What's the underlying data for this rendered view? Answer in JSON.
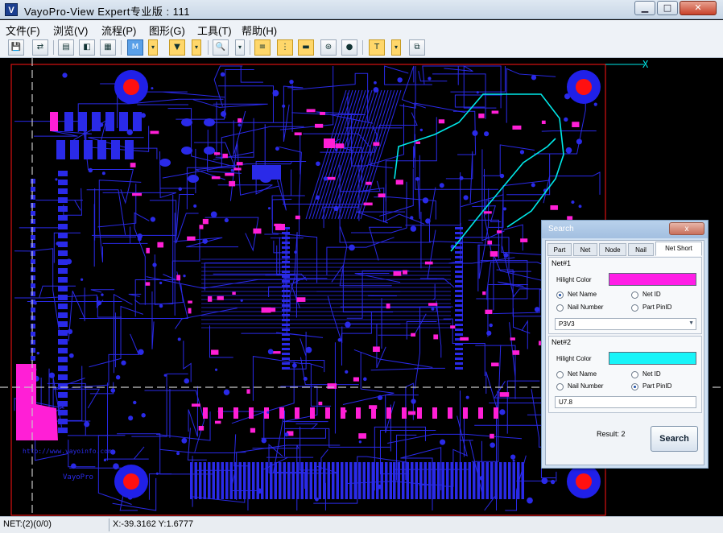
{
  "window": {
    "title": "VayoPro-View Expert专业版 : 111",
    "icon_letter": "V",
    "controls": {
      "minimize": "▁",
      "maximize": "□",
      "close": "✕"
    }
  },
  "menu": [
    {
      "label": "文件(F)"
    },
    {
      "label": "浏览(V)"
    },
    {
      "label": "流程(P)"
    },
    {
      "label": "图形(G)"
    },
    {
      "label": "工具(T)"
    },
    {
      "label": "帮助(H)"
    }
  ],
  "toolbar": {
    "glyphs": [
      "💾",
      "⇄",
      "▤",
      "◧",
      "▦",
      "M",
      "▾",
      "▼",
      "▾",
      "🔍",
      "▾",
      "≡",
      "⋮",
      "▬",
      "⊛",
      "●",
      "T",
      "▾",
      "⧉"
    ]
  },
  "canvas": {
    "axis_label": "X",
    "board_text": "http://www.vayoinfo.com",
    "board_logo_text": "VayoPro",
    "colors": {
      "background": "#000000",
      "board_outline": "#d81010",
      "trace": "#2a2ae8",
      "pad": "#ff1fd6",
      "hole": "#ff1010",
      "highlight_net": "#00e8e8",
      "crosshair": "#c8c8c8"
    }
  },
  "status": {
    "net": "NET:(2)(0/0)",
    "coords": "X:-39.3162 Y:1.6777"
  },
  "search_dialog": {
    "title": "Search",
    "close_label": "x",
    "tabs": [
      "Part",
      "Net",
      "Node",
      "Nail",
      "Net Short"
    ],
    "active_tab": "Net Short",
    "net1": {
      "title": "Net#1",
      "hilight_label": "Hilight Color",
      "hilight_color": "#ff1ee6",
      "options": [
        "Net Name",
        "Net ID",
        "Nail Number",
        "Part PinID"
      ],
      "selected": "Net Name",
      "value": "P3V3"
    },
    "net2": {
      "title": "Net#2",
      "hilight_label": "Hilight Color",
      "hilight_color": "#18f4f8",
      "options": [
        "Net Name",
        "Net ID",
        "Nail Number",
        "Part PinID"
      ],
      "selected": "Part PinID",
      "value": "U7.8"
    },
    "result": "Result: 2",
    "search_button": "Search"
  }
}
